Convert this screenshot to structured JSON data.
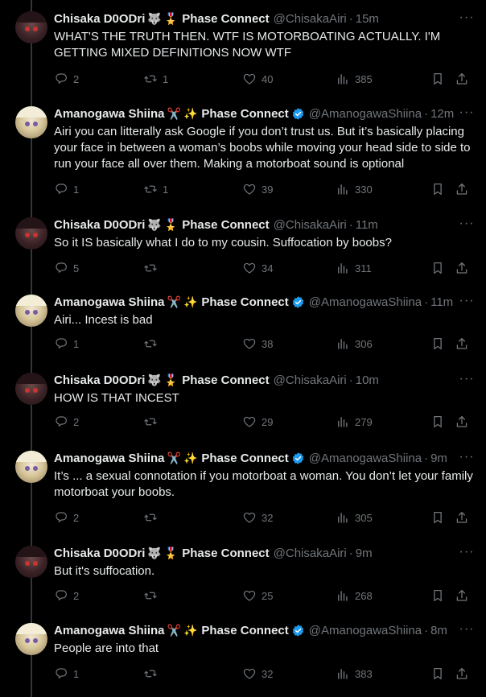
{
  "colors": {
    "background": "#000000",
    "text": "#e7e9ea",
    "muted": "#71767b",
    "verified": "#1d9bf0"
  },
  "tweets": [
    {
      "name": "Chisaka D0ODri",
      "emojis": [
        "🐺",
        "🎖️"
      ],
      "affiliation": "Phase Connect",
      "verified": false,
      "handle": "@ChisakaAiri",
      "time": "15m",
      "text": "WHAT'S THE TRUTH THEN. WTF IS MOTORBOATING ACTUALLY. I'M GETTING MIXED DEFINITIONS NOW WTF",
      "replies": "2",
      "retweets": "1",
      "likes": "40",
      "views": "385"
    },
    {
      "name": "Amanogawa Shiina",
      "emojis": [
        "✂️",
        "✨"
      ],
      "affiliation": "Phase Connect",
      "verified": true,
      "handle": "@AmanogawaShiina",
      "time": "12m",
      "text": "Airi you can litterally ask Google if you don’t trust us. But it’s basically placing your face in between a woman’s boobs while moving your head side to side to run your face all over them. Making a motorboat sound is optional",
      "replies": "1",
      "retweets": "1",
      "likes": "39",
      "views": "330"
    },
    {
      "name": "Chisaka D0ODri",
      "emojis": [
        "🐺",
        "🎖️"
      ],
      "affiliation": "Phase Connect",
      "verified": false,
      "handle": "@ChisakaAiri",
      "time": "11m",
      "text": "So it IS basically what I do to my cousin. Suffocation by boobs?",
      "replies": "5",
      "retweets": "",
      "likes": "34",
      "views": "311"
    },
    {
      "name": "Amanogawa Shiina",
      "emojis": [
        "✂️",
        "✨"
      ],
      "affiliation": "Phase Connect",
      "verified": true,
      "handle": "@AmanogawaShiina",
      "time": "11m",
      "text": "Airi... Incest is bad",
      "replies": "1",
      "retweets": "",
      "likes": "38",
      "views": "306"
    },
    {
      "name": "Chisaka D0ODri",
      "emojis": [
        "🐺",
        "🎖️"
      ],
      "affiliation": "Phase Connect",
      "verified": false,
      "handle": "@ChisakaAiri",
      "time": "10m",
      "text": "HOW IS THAT INCEST",
      "replies": "2",
      "retweets": "",
      "likes": "29",
      "views": "279"
    },
    {
      "name": "Amanogawa Shiina",
      "emojis": [
        "✂️",
        "✨"
      ],
      "affiliation": "Phase Connect",
      "verified": true,
      "handle": "@AmanogawaShiina",
      "time": "9m",
      "text": "It’s ... a sexual connotation if you motorboat a woman. You don’t let your family motorboat your boobs.",
      "replies": "2",
      "retweets": "",
      "likes": "32",
      "views": "305"
    },
    {
      "name": "Chisaka D0ODri",
      "emojis": [
        "🐺",
        "🎖️"
      ],
      "affiliation": "Phase Connect",
      "verified": false,
      "handle": "@ChisakaAiri",
      "time": "9m",
      "text": "But it's suffocation.",
      "replies": "2",
      "retweets": "",
      "likes": "25",
      "views": "268"
    },
    {
      "name": "Amanogawa Shiina",
      "emojis": [
        "✂️",
        "✨"
      ],
      "affiliation": "Phase Connect",
      "verified": true,
      "handle": "@AmanogawaShiina",
      "time": "8m",
      "text": "People are into that",
      "replies": "1",
      "retweets": "",
      "likes": "32",
      "views": "383"
    }
  ]
}
